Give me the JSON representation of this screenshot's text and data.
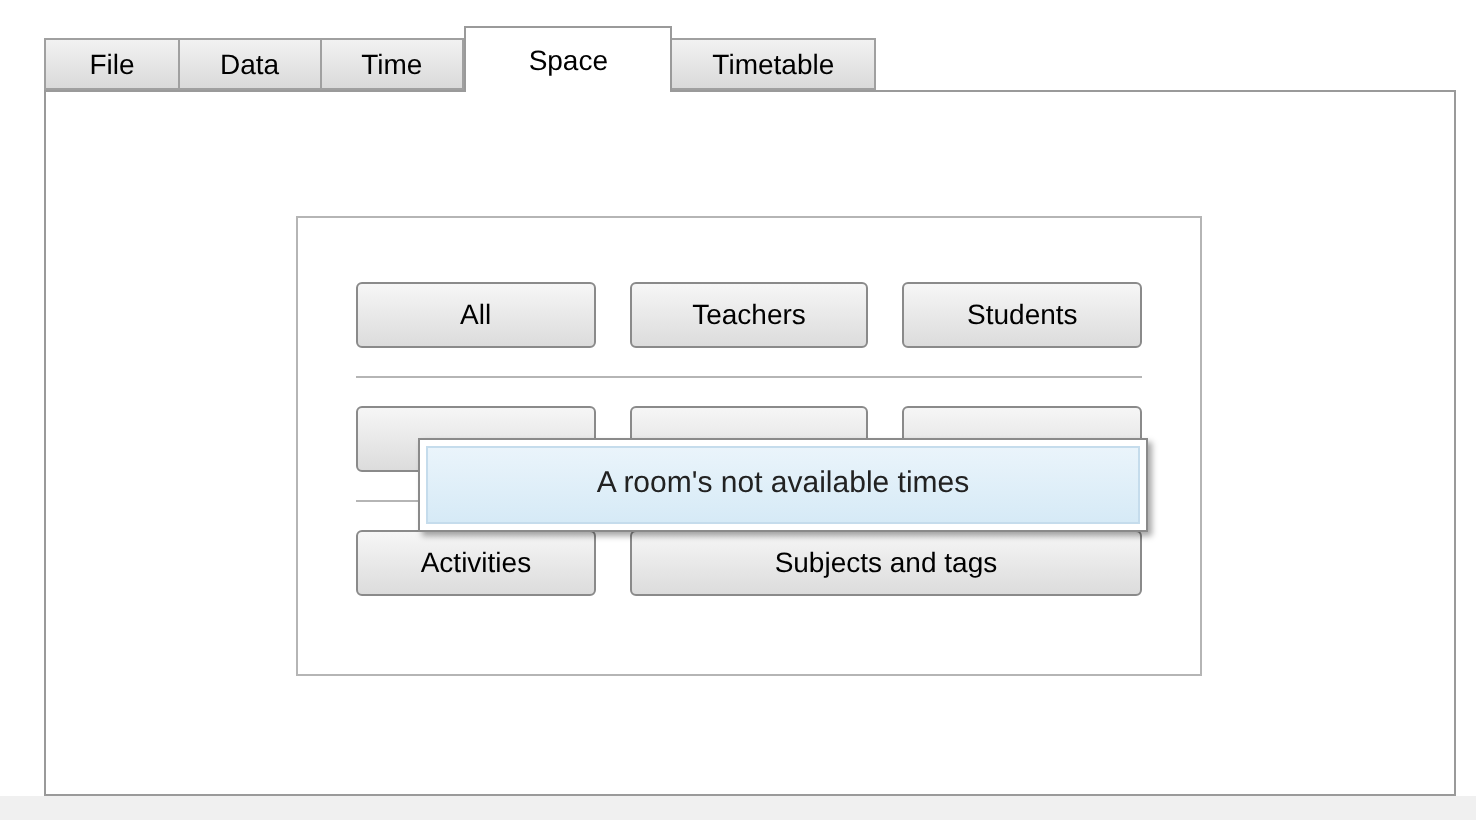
{
  "tabs": [
    {
      "label": "File",
      "selected": false
    },
    {
      "label": "Data",
      "selected": false
    },
    {
      "label": "Time",
      "selected": false
    },
    {
      "label": "Space",
      "selected": true
    },
    {
      "label": "Timetable",
      "selected": false
    }
  ],
  "rows": [
    {
      "buttons": [
        {
          "label": "All",
          "kind": "normal"
        },
        {
          "label": "Teachers",
          "kind": "normal"
        },
        {
          "label": "Students",
          "kind": "normal"
        }
      ]
    },
    {
      "buttons": [
        {
          "kind": "covered"
        },
        {
          "kind": "covered"
        },
        {
          "kind": "covered"
        }
      ]
    },
    {
      "buttons": [
        {
          "label": "Activities",
          "kind": "normal"
        },
        {
          "label": "Subjects and tags",
          "kind": "wide"
        }
      ]
    }
  ],
  "tooltip": {
    "text": "A room's not available times"
  }
}
